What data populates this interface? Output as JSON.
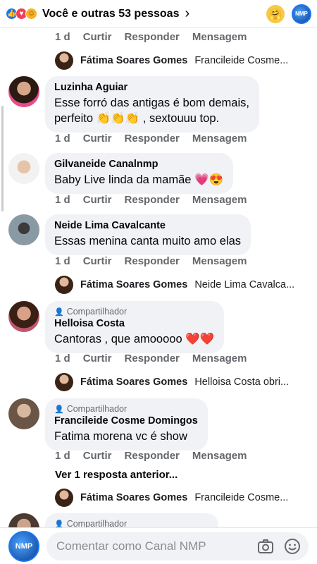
{
  "header": {
    "title": "Você e outras 53 pessoas",
    "page_logo": "NMP"
  },
  "actions": {
    "time": "1 d",
    "like": "Curtir",
    "reply": "Responder",
    "message": "Mensagem"
  },
  "reply_previews": [
    {
      "name": "Fátima Soares Gomes",
      "text": "Francileide Cosme..."
    },
    {
      "name": "Fátima Soares Gomes",
      "text": "Neide Lima Cavalca..."
    },
    {
      "name": "Fátima Soares Gomes",
      "text": "Helloisa Costa obri..."
    },
    {
      "name": "Fátima Soares Gomes",
      "text": "Francileide Cosme..."
    }
  ],
  "comments": [
    {
      "name": "Luzinha Aguiar",
      "text_line1": "Esse forró das antigas é bom demais,",
      "text_line2": "perfeito 👏👏👏 , sextouuu top."
    },
    {
      "name": "Gilvaneide Canalnmp",
      "text": "Baby Live linda da mamãe 💗😍"
    },
    {
      "name": "Neide Lima Cavalcante",
      "text": "Essas menina canta muito amo elas"
    },
    {
      "badge": "Compartilhador",
      "name": "Helloisa Costa",
      "text": "Cantoras , que amooooo ❤️❤️"
    },
    {
      "badge": "Compartilhador",
      "name": "Francileide Cosme Domingos",
      "text": "Fatima morena vc é show"
    },
    {
      "badge": "Compartilhador"
    }
  ],
  "more_replies": "Ver 1 resposta anterior...",
  "composer": {
    "placeholder": "Comentar como Canal NMP",
    "avatar_label": "NMP"
  },
  "icons": [
    "like-reaction-icon",
    "love-reaction-icon",
    "care-reaction-icon",
    "chevron-right-icon",
    "care-emoji-icon",
    "camera-icon",
    "emoji-icon",
    "person-icon"
  ]
}
